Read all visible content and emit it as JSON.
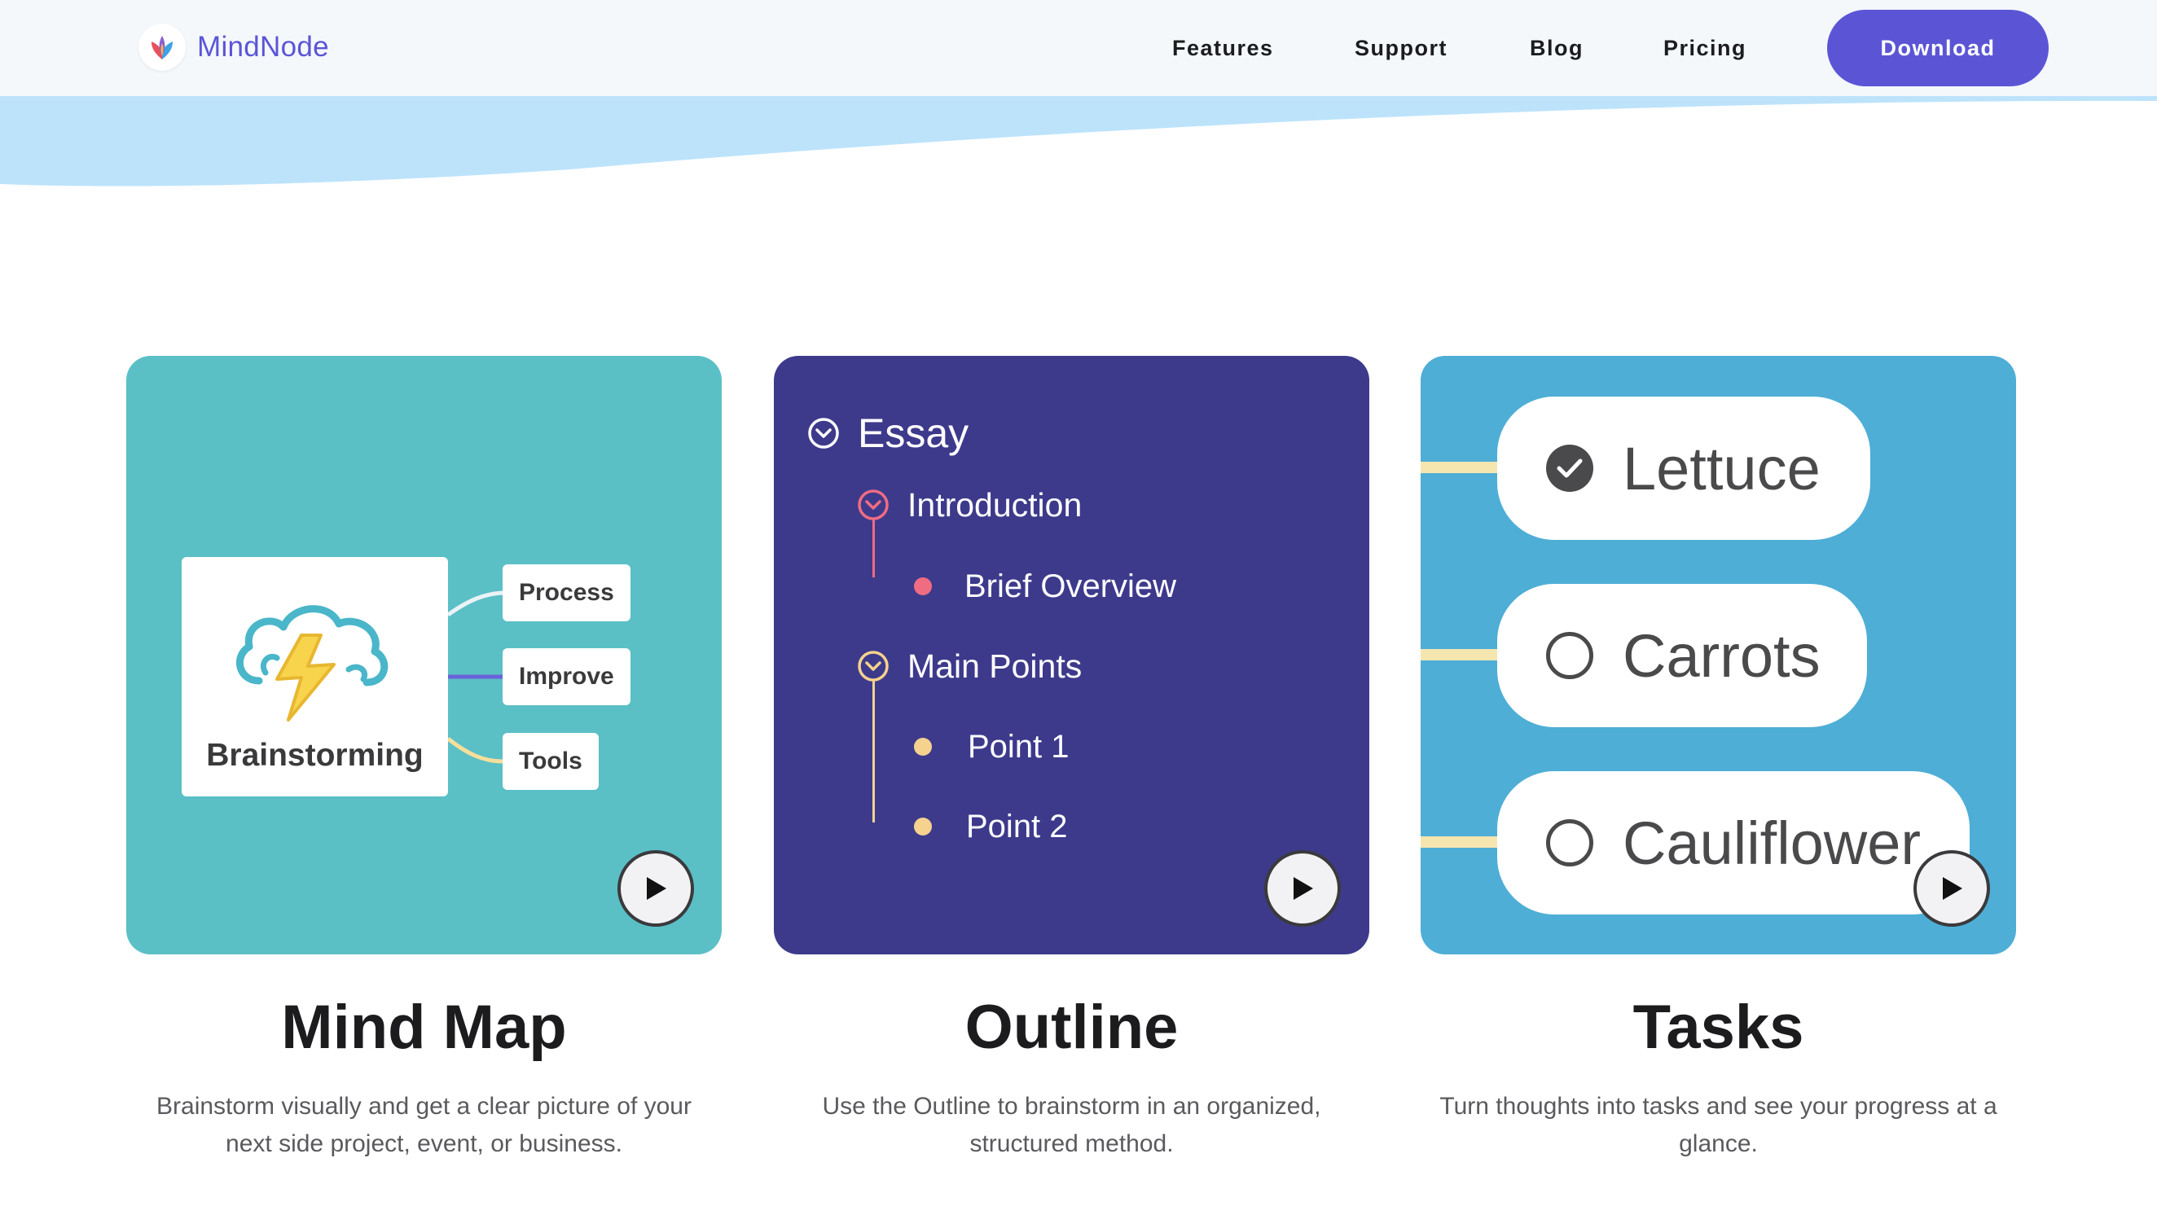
{
  "brand": {
    "name": "MindNode",
    "accent": "#5b55d6"
  },
  "nav": {
    "items": [
      {
        "label": "Features"
      },
      {
        "label": "Support"
      },
      {
        "label": "Blog"
      },
      {
        "label": "Pricing"
      }
    ],
    "download_label": "Download"
  },
  "features": [
    {
      "title": "Mind Map",
      "description": "Brainstorm visually and get a clear picture of your next side project, event, or business.",
      "card_color": "#5bbfc6",
      "mindmap": {
        "central": {
          "label": "Brainstorming",
          "icon": "storm-cloud-icon"
        },
        "branches": [
          {
            "label": "Process",
            "color": "#e9f3f6"
          },
          {
            "label": "Improve",
            "color": "#6a63d8"
          },
          {
            "label": "Tools",
            "color": "#f5df9a"
          }
        ]
      }
    },
    {
      "title": "Outline",
      "description": "Use the Outline to brainstorm in an organized, structured method.",
      "card_color": "#3d3a8c",
      "outline": {
        "root": "Essay",
        "sections": [
          {
            "label": "Introduction",
            "color": "#f06c82",
            "children": [
              "Brief Overview"
            ]
          },
          {
            "label": "Main Points",
            "color": "#f5d28e",
            "children": [
              "Point 1",
              "Point 2"
            ]
          }
        ]
      }
    },
    {
      "title": "Tasks",
      "description": "Turn thoughts into tasks and see your progress at a glance.",
      "card_color": "#4eaed6",
      "tasks": [
        {
          "label": "Lettuce",
          "done": true
        },
        {
          "label": "Carrots",
          "done": false
        },
        {
          "label": "Cauliflower",
          "done": false
        }
      ]
    }
  ]
}
